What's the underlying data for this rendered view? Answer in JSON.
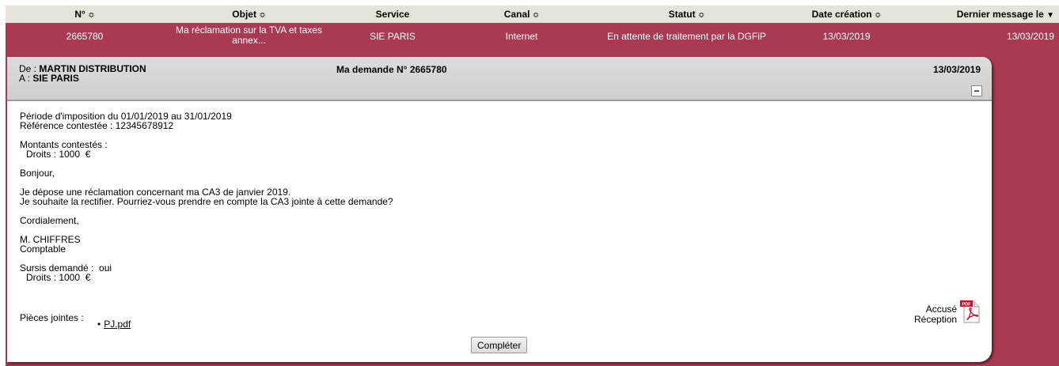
{
  "table": {
    "headers": {
      "num": "N°",
      "objet": "Objet",
      "service": "Service",
      "canal": "Canal",
      "statut": "Statut",
      "date_creation": "Date création",
      "dernier_message": "Dernier message le"
    },
    "row": {
      "num": "2665780",
      "objet_line1": "Ma réclamation sur la TVA et taxes",
      "objet_line2": "annex...",
      "service": "SIE PARIS",
      "canal": "Internet",
      "statut": "En attente de traitement par la DGFiP",
      "date_creation": "13/03/2019",
      "dernier_message": "13/03/2019"
    }
  },
  "message": {
    "from_label": "De :",
    "from_value": "MARTIN DISTRIBUTION",
    "to_label": "A :",
    "to_value": "SIE PARIS",
    "subject": "Ma demande N° 2665780",
    "date": "13/03/2019",
    "collapse_symbol": "−",
    "lines": {
      "periode": "Période d'imposition du 01/01/2019 au 31/01/2019",
      "reference": "Référence contestée : 12345678912",
      "montants": "Montants contestés :",
      "droits1": "Droits : 1000  €",
      "bonjour": "Bonjour,",
      "para1": "Je dépose une réclamation concernant ma CA3 de janvier 2019.",
      "para2": "Je souhaite la rectifier. Pourriez-vous prendre en compte la CA3 jointe à cette demande?",
      "cordialement": "Cordialement,",
      "signature_name": "M. CHIFFRES",
      "signature_role": "Comptable",
      "sursis": "Sursis demandé :  oui",
      "droits2": "Droits : 1000  €"
    },
    "attachments_label": "Pièces jointes :",
    "attachments": [
      "PJ.pdf"
    ],
    "accuse_line1": "Accusé",
    "accuse_line2": "Réception",
    "pdf_badge": "PDF",
    "completer_label": "Compléter"
  },
  "icons": {
    "sort": "⇕",
    "sort_desc": "▼"
  },
  "colors": {
    "header_bg": "#e6e3d8",
    "accent": "#a93a52",
    "card_header_bg": "#d6d6d6"
  }
}
